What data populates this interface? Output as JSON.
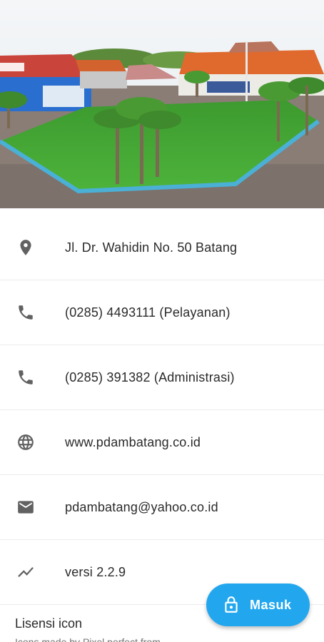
{
  "contact": {
    "address": "Jl. Dr. Wahidin No. 50 Batang",
    "phone_service": "(0285) 4493111 (Pelayanan)",
    "phone_admin": "(0285) 391382 (Administrasi)",
    "website": "www.pdambatang.co.id",
    "email": "pdambatang@yahoo.co.id",
    "version": "versi 2.2.9"
  },
  "license": {
    "title": "Lisensi icon",
    "subtitle": "Icons made by Pixel perfect from"
  },
  "fab": {
    "label": "Masuk"
  },
  "icons": {
    "address": "location-pin-icon",
    "phone": "phone-icon",
    "website": "globe-icon",
    "email": "mail-icon",
    "version": "trending-icon",
    "fab": "lock-icon"
  },
  "colors": {
    "accent": "#22a7ef",
    "icon": "#616161"
  }
}
